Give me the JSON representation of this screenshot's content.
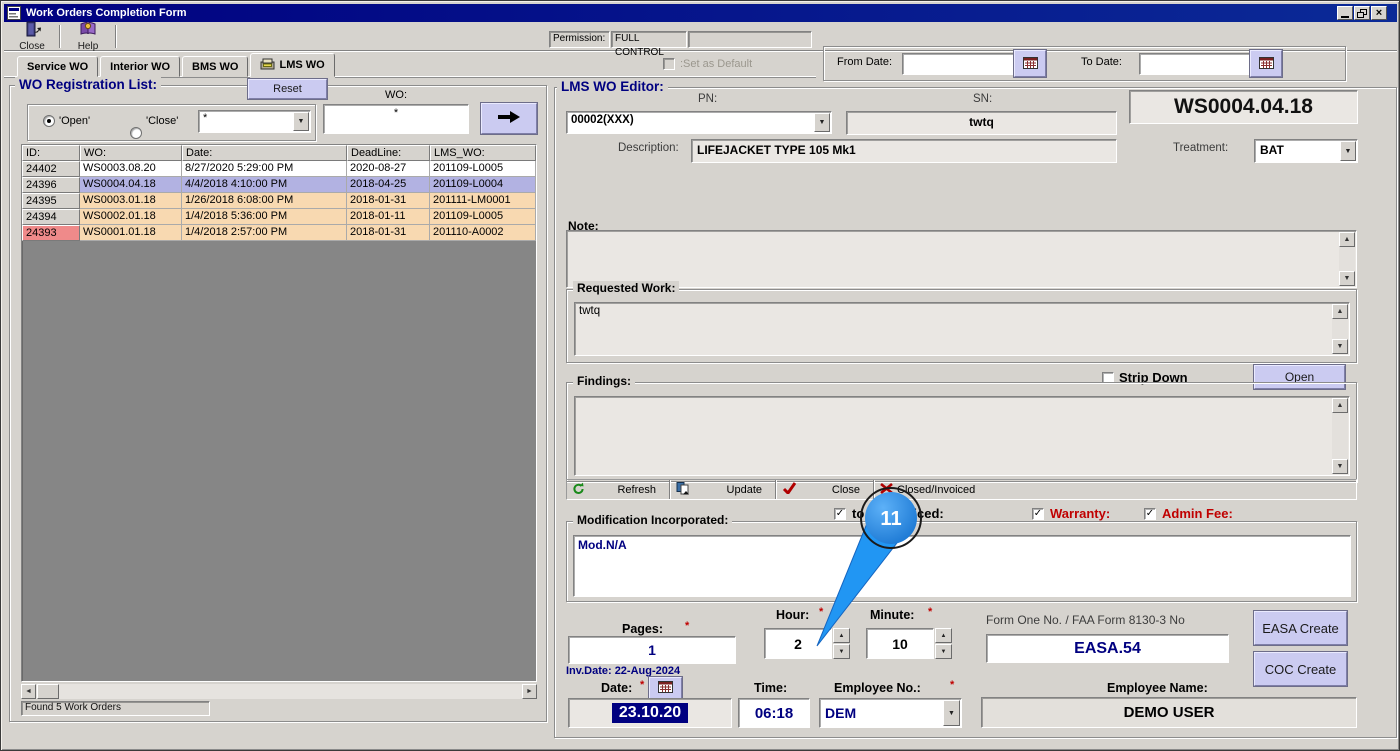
{
  "colors": {
    "titlebar": "#000080",
    "window_bg": "#d6d3ce",
    "accent_button": "#cbcbf1",
    "row_selected": "#b2b2e2",
    "row_warning": "#f8d9b1",
    "cell_alert": "#ef8a8a",
    "value_text": "#000080",
    "alert_text": "#c00000",
    "annotation_blue": "#2196f3"
  },
  "icons": {
    "dropdown_arrow": "▼",
    "spin_up": "▲",
    "spin_down": "▼",
    "scroll_up": "▲",
    "scroll_down": "▼",
    "scroll_left": "◄",
    "scroll_right": "►",
    "check": "✓",
    "window_close": "×",
    "required_marker": "*"
  },
  "window": {
    "title": "Work Orders Completion Form"
  },
  "toolbar": {
    "close_label": "Close",
    "help_label": "Help",
    "permission_label": "Permission:",
    "permission_value": "FULL CONTROL"
  },
  "tabs": {
    "service": "Service WO",
    "interior": "Interior WO",
    "bms": "BMS WO",
    "lms": "LMS WO",
    "set_default": ":Set as Default"
  },
  "date_range": {
    "from_label": "From Date:",
    "from_value": "",
    "to_label": "To Date:",
    "to_value": ""
  },
  "wo_list": {
    "title": "WO Registration List:",
    "reset_button": "Reset",
    "radio_open": "'Open'",
    "radio_close": "'Close'",
    "filter_value": "*",
    "wo_label": "WO:",
    "wo_value": "*",
    "columns": [
      "ID:",
      "WO:",
      "Date:",
      "DeadLine:",
      "LMS_WO:"
    ],
    "rows": [
      {
        "id": "24402",
        "wo": "WS0003.08.20",
        "date": "8/27/2020 5:29:00 PM",
        "deadline": "2020-08-27",
        "lms": "201109-L0005"
      },
      {
        "id": "24396",
        "wo": "WS0004.04.18",
        "date": "4/4/2018 4:10:00 PM",
        "deadline": "2018-04-25",
        "lms": "201109-L0004"
      },
      {
        "id": "24395",
        "wo": "WS0003.01.18",
        "date": "1/26/2018 6:08:00 PM",
        "deadline": "2018-01-31",
        "lms": "201111-LM0001"
      },
      {
        "id": "24394",
        "wo": "WS0002.01.18",
        "date": "1/4/2018 5:36:00 PM",
        "deadline": "2018-01-11",
        "lms": "201109-L0005"
      },
      {
        "id": "24393",
        "wo": "WS0001.01.18",
        "date": "1/4/2018 2:57:00 PM",
        "deadline": "2018-01-31",
        "lms": "201110-A0002"
      }
    ],
    "status": "Found 5 Work Orders"
  },
  "editor": {
    "title": "LMS WO Editor:",
    "pn_label": "PN:",
    "pn_value": "00002(XXX)",
    "sn_label": "SN:",
    "sn_value": "twtq",
    "wo_number": "WS0004.04.18",
    "description_label": "Description:",
    "description_value": "LIFEJACKET TYPE 105 Mk1",
    "treatment_label": "Treatment:",
    "treatment_value": "BAT",
    "note_label": "Note:",
    "note_value": "",
    "requested_work_label": "Requested Work:",
    "requested_work_value": "twtq",
    "strip_down_label": "Strip Down",
    "open_button": "Open",
    "findings_label": "Findings:",
    "findings_value": "",
    "refresh_button": "Refresh",
    "update_button": "Update",
    "close_button": "Close",
    "closed_invoiced_button": "Closed/Invoiced",
    "to_be_invoiced_label": "to be invoiced:",
    "warranty_label": "Warranty:",
    "admin_fee_label": "Admin Fee:",
    "modification_label": "Modification Incorporated:",
    "modification_value": "Mod.N/A",
    "pages_label": "Pages:",
    "pages_value": "1",
    "hour_label": "Hour:",
    "hour_value": "2",
    "minute_label": "Minute:",
    "minute_value": "10",
    "form_one_label": "Form One No. / FAA Form 8130-3 No",
    "form_one_value": "EASA.54",
    "easa_create_button": "EASA Create",
    "coc_create_button": "COC Create",
    "inv_date": "Inv.Date: 22-Aug-2024",
    "date_label": "Date:",
    "date_value": "23.10.20",
    "time_label": "Time:",
    "time_value": "06:18",
    "employee_no_label": "Employee No.:",
    "employee_no_value": "DEM",
    "employee_name_label": "Employee Name:",
    "employee_name_value": "DEMO USER"
  },
  "annotation": {
    "badge": "11"
  }
}
